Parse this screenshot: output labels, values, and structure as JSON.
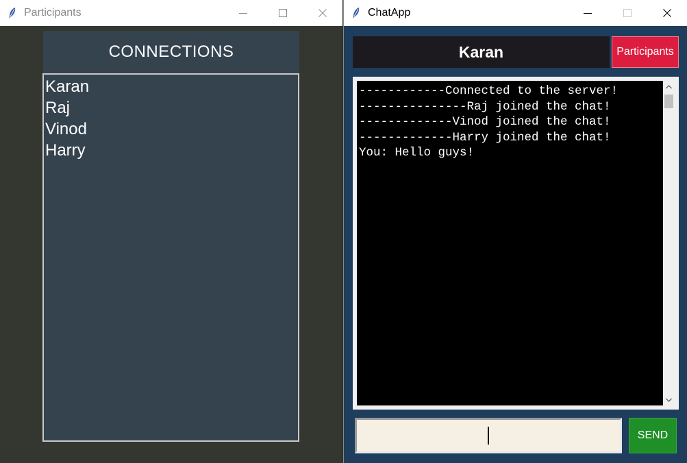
{
  "participants_window": {
    "title": "Participants",
    "header": "CONNECTIONS",
    "connections": [
      "Karan",
      "Raj",
      "Vinod",
      "Harry"
    ]
  },
  "chat_window": {
    "title": "ChatApp",
    "user_name": "Karan",
    "participants_button": "Participants",
    "messages": [
      "------------Connected to the server!",
      "---------------Raj joined the chat!",
      "-------------Vinod joined the chat!",
      "-------------Harry joined the chat!",
      "You: Hello guys!"
    ],
    "message_input_value": "",
    "send_button": "SEND"
  },
  "colors": {
    "participants_bg": "#333730",
    "list_bg": "#35434f",
    "chat_bg": "#1f3d5c",
    "name_bar_bg": "#1c1a1e",
    "participants_btn_bg": "#dc1d3f",
    "send_btn_bg": "#1f8f28",
    "input_bg": "#f5efe4"
  },
  "icons": {
    "app_icon": "feather-icon",
    "minimize": "minimize-icon",
    "maximize": "maximize-icon",
    "close": "close-icon"
  }
}
